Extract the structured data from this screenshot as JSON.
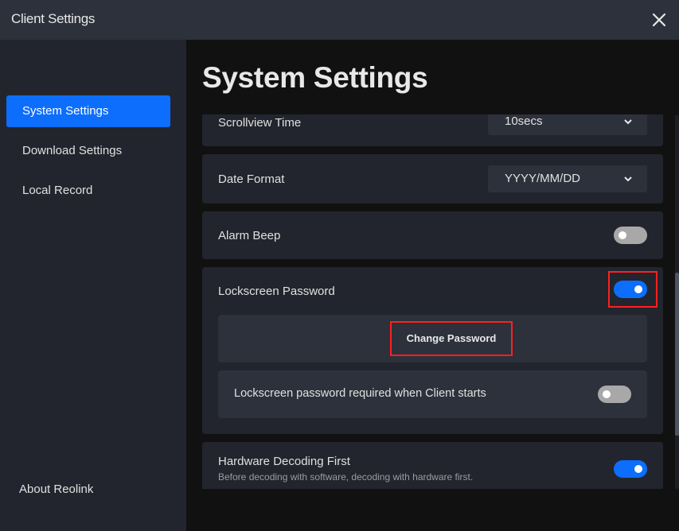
{
  "window": {
    "title": "Client Settings",
    "close_icon": "close-icon"
  },
  "sidebar": {
    "items": [
      {
        "label": "System Settings",
        "active": true
      },
      {
        "label": "Download Settings",
        "active": false
      },
      {
        "label": "Local Record",
        "active": false
      }
    ],
    "about_label": "About Reolink"
  },
  "main": {
    "title": "System Settings",
    "settings": {
      "scrollview_time": {
        "label": "Scrollview Time",
        "value": "10secs"
      },
      "date_format": {
        "label": "Date Format",
        "value": "YYYY/MM/DD"
      },
      "alarm_beep": {
        "label": "Alarm Beep",
        "enabled": false
      },
      "lockscreen_password": {
        "label": "Lockscreen Password",
        "enabled": true,
        "change_password_label": "Change Password",
        "required_on_start": {
          "label": "Lockscreen password required when Client starts",
          "enabled": false
        }
      },
      "hardware_decoding": {
        "label": "Hardware Decoding First",
        "description": "Before decoding with software, decoding with hardware first.",
        "enabled": true
      }
    }
  },
  "colors": {
    "accent": "#0d6efd",
    "highlight": "#ff2020",
    "toggle_off": "#a8a8a8"
  }
}
